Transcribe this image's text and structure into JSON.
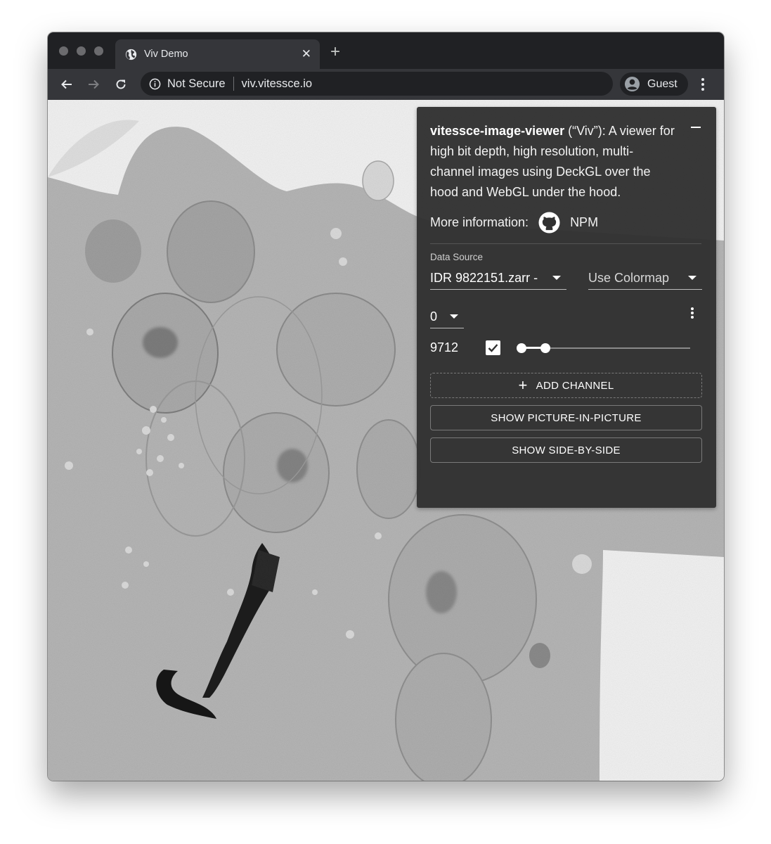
{
  "browser": {
    "tab_title": "Viv Demo",
    "tab_icon": "globe-icon",
    "new_tab_label": "+",
    "security_label": "Not Secure",
    "url": "viv.vitessce.io",
    "profile_label": "Guest"
  },
  "panel": {
    "title_bold": "vitessce-image-viewer",
    "title_rest": " (“Viv”): A viewer for high bit depth, high resolution, multi-channel images using DeckGL over the hood and WebGL under the hood.",
    "more_info_label": "More information:",
    "github_icon": "github-icon",
    "npm_label": "NPM",
    "data_source_label": "Data Source",
    "data_source_value": "IDR 9822151.zarr -",
    "colormap_value": "Use Colormap",
    "channel": {
      "selected": "0",
      "value_label": "9712",
      "checked": true,
      "slider_range": [
        0.0,
        0.14
      ]
    },
    "buttons": {
      "add_channel": "ADD CHANNEL",
      "picture_in_picture": "SHOW PICTURE-IN-PICTURE",
      "side_by_side": "SHOW SIDE-BY-SIDE"
    }
  },
  "colors": {
    "titlebar": "#202124",
    "toolbar": "#35363a",
    "panel_bg": "#303030",
    "text": "#ffffff"
  }
}
